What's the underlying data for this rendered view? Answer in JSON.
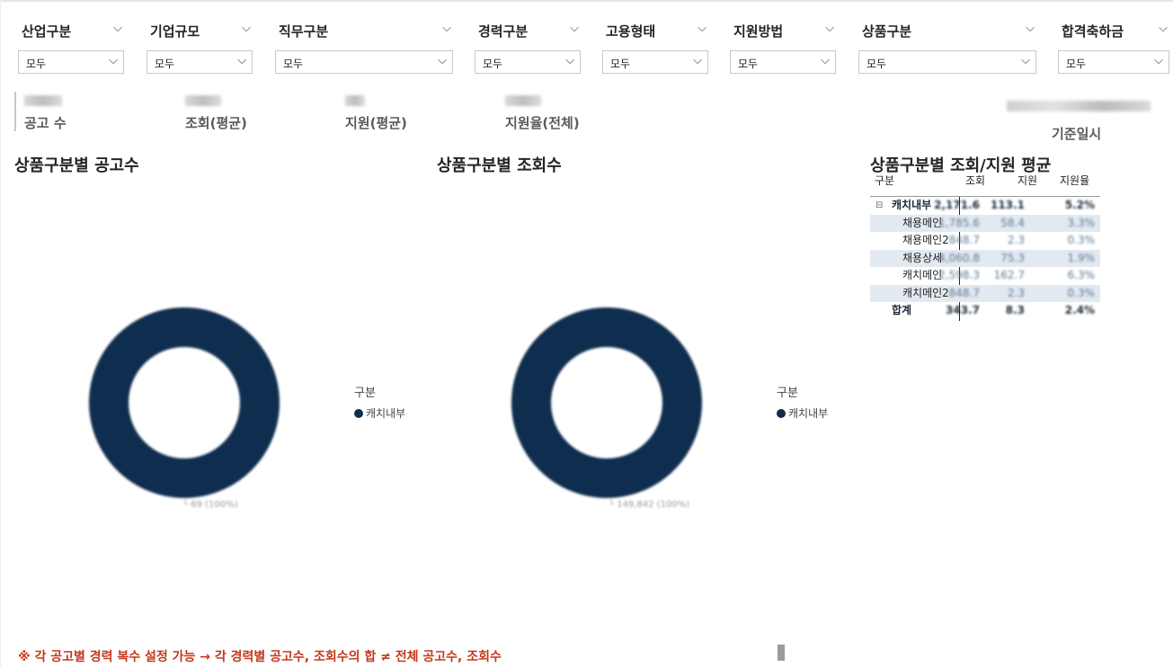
{
  "filters": [
    {
      "title": "산업구분",
      "value": "모두"
    },
    {
      "title": "기업규모",
      "value": "모두"
    },
    {
      "title": "직무구분",
      "value": "모두"
    },
    {
      "title": "경력구분",
      "value": "모두"
    },
    {
      "title": "고용형태",
      "value": "모두"
    },
    {
      "title": "지원방법",
      "value": "모두"
    },
    {
      "title": "상품구분",
      "value": "모두"
    },
    {
      "title": "합격축하금",
      "value": "모두"
    }
  ],
  "kpis": [
    {
      "label": "공고 수"
    },
    {
      "label": "조회(평균)"
    },
    {
      "label": "지원(평균)"
    },
    {
      "label": "지원율(전체)"
    }
  ],
  "as_of": {
    "label": "기준일시"
  },
  "charts": {
    "count_title": "상품구분별 공고수",
    "views_title": "상품구분별 조회수",
    "table_title": "상품구분별 조회/지원 평균"
  },
  "chart_data": [
    {
      "type": "pie",
      "title": "상품구분별 공고수",
      "legend_title": "구분",
      "categories": [
        "캐치내부"
      ],
      "values": [
        69
      ],
      "data_label": "69 (100%)",
      "colors": [
        "#0f2d4e"
      ]
    },
    {
      "type": "pie",
      "title": "상품구분별 조회수",
      "legend_title": "구분",
      "categories": [
        "캐치내부"
      ],
      "values": [
        149842
      ],
      "data_label": "149,842 (100%)",
      "colors": [
        "#0f2d4e"
      ]
    },
    {
      "type": "table",
      "title": "상품구분별 조회/지원 평균",
      "columns": [
        "구분",
        "조회",
        "지원",
        "지원율"
      ],
      "rows": [
        {
          "label": "캐치내부",
          "level": 0,
          "expanded": true,
          "values": [
            "2,171.6",
            "113.1",
            "5.2%"
          ]
        },
        {
          "label": "채용메인",
          "level": 1,
          "values": [
            "1,785.6",
            "58.4",
            "3.3%"
          ]
        },
        {
          "label": "채용메인2",
          "level": 1,
          "values": [
            "848.7",
            "2.3",
            "0.3%"
          ]
        },
        {
          "label": "채용상세",
          "level": 1,
          "values": [
            "4,060.8",
            "75.3",
            "1.9%"
          ]
        },
        {
          "label": "캐치메인",
          "level": 1,
          "values": [
            "2,598.3",
            "162.7",
            "6.3%"
          ]
        },
        {
          "label": "캐치메인2",
          "level": 1,
          "values": [
            "848.7",
            "2.3",
            "0.3%"
          ]
        }
      ],
      "total": {
        "label": "합계",
        "values": [
          "343.7",
          "8.3",
          "2.4%"
        ]
      }
    }
  ],
  "footnote": "※ 각 공고별 경력 복수 설정 가능 → 각 경력별 공고수, 조회수의 합 ≠ 전체 공고수, 조회수",
  "colors": {
    "donut": "#0f2d4e",
    "note": "#c0391b",
    "row_shade": "#e3e9f0"
  }
}
